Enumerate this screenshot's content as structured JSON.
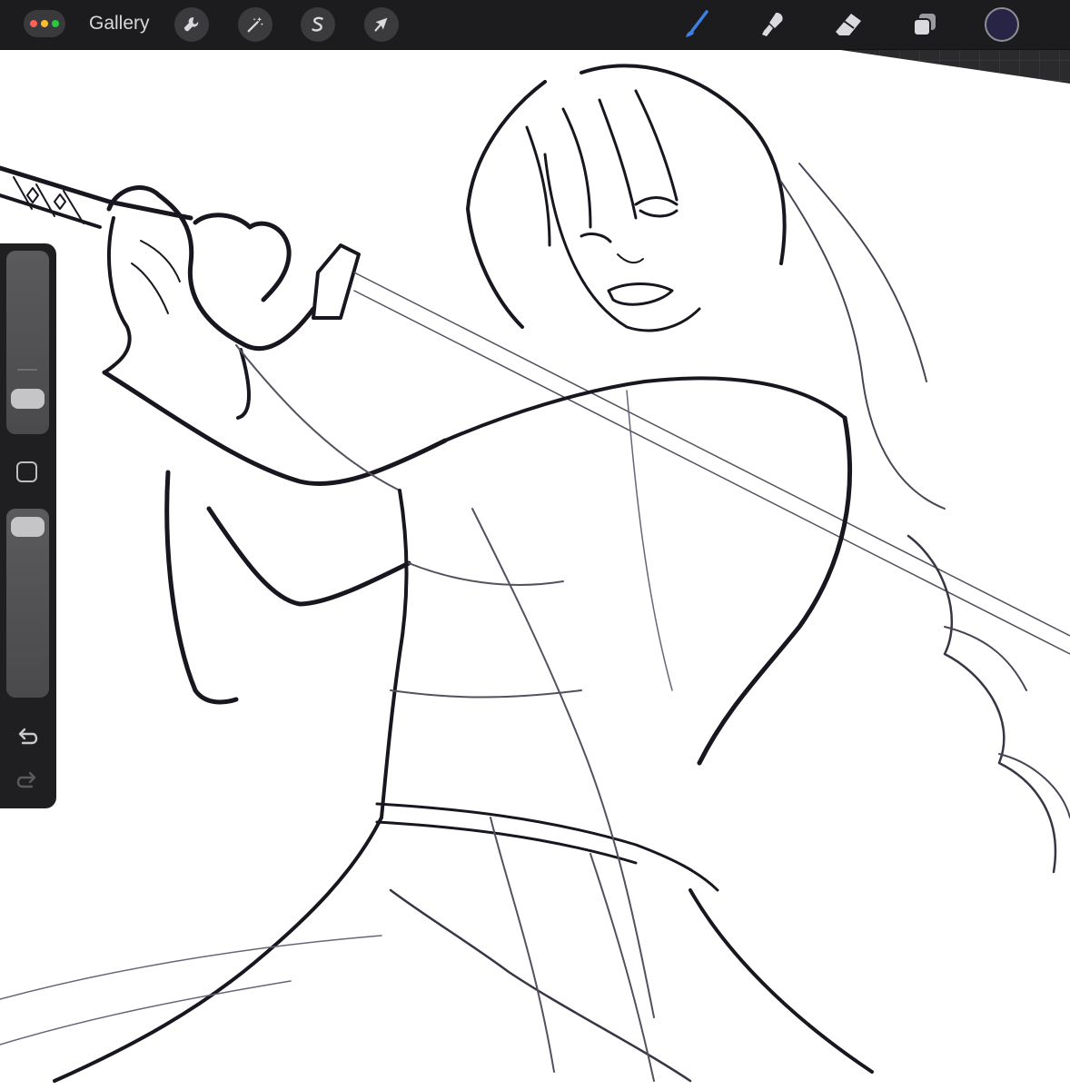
{
  "app": {
    "gallery_label": "Gallery"
  },
  "window_controls": {
    "colors": [
      "#ff5f57",
      "#febc2e",
      "#28c840"
    ]
  },
  "toolbar": {
    "left_tools": [
      {
        "name": "actions",
        "icon": "wrench-icon"
      },
      {
        "name": "adjustments",
        "icon": "magic-wand-icon"
      },
      {
        "name": "selection",
        "icon": "selection-s-icon"
      },
      {
        "name": "transform",
        "icon": "arrow-cursor-icon"
      }
    ],
    "right_tools": [
      {
        "name": "brush",
        "icon": "brush-icon",
        "active": true,
        "color": "#3d7fe6"
      },
      {
        "name": "smudge",
        "icon": "smudge-icon",
        "active": false
      },
      {
        "name": "eraser",
        "icon": "eraser-icon",
        "active": false
      },
      {
        "name": "layers",
        "icon": "layers-icon",
        "active": false
      }
    ],
    "current_color": "#272445"
  },
  "sidebar": {
    "brush_size_level": 0.19,
    "opacity_level": 0.94,
    "modify_button_icon": "square-icon",
    "undo_icon": "undo-arrow-icon",
    "redo_icon": "redo-arrow-icon"
  },
  "canvas": {
    "background": "#ffffff",
    "line_color": "#1a1620"
  }
}
